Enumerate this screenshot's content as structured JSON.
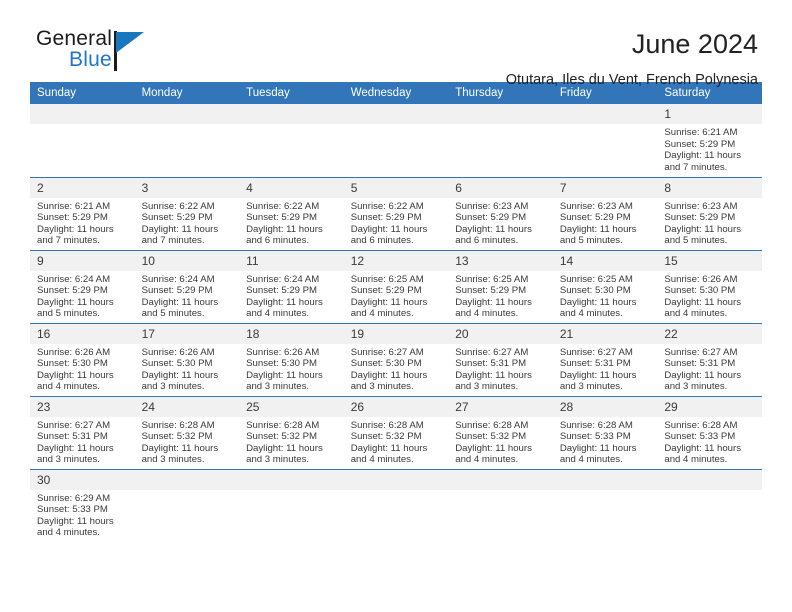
{
  "logo": {
    "general": "General",
    "blue": "Blue",
    "triangle_color": "#1878bd",
    "text_color": "#1b1b1b",
    "blue_color": "#2176c7"
  },
  "header": {
    "title": "June 2024",
    "subtitle": "Otutara, Iles du Vent, French Polynesia"
  },
  "theme": {
    "header_row_bg": "#3275b8",
    "header_row_text": "#ffffff",
    "day_number_bg": "#f1f1f1",
    "row_separator": "#3275b8",
    "body_text": "#3a3a3a"
  },
  "weekday_headers": [
    "Sunday",
    "Monday",
    "Tuesday",
    "Wednesday",
    "Thursday",
    "Friday",
    "Saturday"
  ],
  "weeks": [
    [
      {
        "day": "",
        "empty": true
      },
      {
        "day": "",
        "empty": true
      },
      {
        "day": "",
        "empty": true
      },
      {
        "day": "",
        "empty": true
      },
      {
        "day": "",
        "empty": true
      },
      {
        "day": "",
        "empty": true
      },
      {
        "day": "1",
        "sunrise": "Sunrise: 6:21 AM",
        "sunset": "Sunset: 5:29 PM",
        "daylight_line1": "Daylight: 11 hours",
        "daylight_line2": "and 7 minutes."
      }
    ],
    [
      {
        "day": "2",
        "sunrise": "Sunrise: 6:21 AM",
        "sunset": "Sunset: 5:29 PM",
        "daylight_line1": "Daylight: 11 hours",
        "daylight_line2": "and 7 minutes."
      },
      {
        "day": "3",
        "sunrise": "Sunrise: 6:22 AM",
        "sunset": "Sunset: 5:29 PM",
        "daylight_line1": "Daylight: 11 hours",
        "daylight_line2": "and 7 minutes."
      },
      {
        "day": "4",
        "sunrise": "Sunrise: 6:22 AM",
        "sunset": "Sunset: 5:29 PM",
        "daylight_line1": "Daylight: 11 hours",
        "daylight_line2": "and 6 minutes."
      },
      {
        "day": "5",
        "sunrise": "Sunrise: 6:22 AM",
        "sunset": "Sunset: 5:29 PM",
        "daylight_line1": "Daylight: 11 hours",
        "daylight_line2": "and 6 minutes."
      },
      {
        "day": "6",
        "sunrise": "Sunrise: 6:23 AM",
        "sunset": "Sunset: 5:29 PM",
        "daylight_line1": "Daylight: 11 hours",
        "daylight_line2": "and 6 minutes."
      },
      {
        "day": "7",
        "sunrise": "Sunrise: 6:23 AM",
        "sunset": "Sunset: 5:29 PM",
        "daylight_line1": "Daylight: 11 hours",
        "daylight_line2": "and 5 minutes."
      },
      {
        "day": "8",
        "sunrise": "Sunrise: 6:23 AM",
        "sunset": "Sunset: 5:29 PM",
        "daylight_line1": "Daylight: 11 hours",
        "daylight_line2": "and 5 minutes."
      }
    ],
    [
      {
        "day": "9",
        "sunrise": "Sunrise: 6:24 AM",
        "sunset": "Sunset: 5:29 PM",
        "daylight_line1": "Daylight: 11 hours",
        "daylight_line2": "and 5 minutes."
      },
      {
        "day": "10",
        "sunrise": "Sunrise: 6:24 AM",
        "sunset": "Sunset: 5:29 PM",
        "daylight_line1": "Daylight: 11 hours",
        "daylight_line2": "and 5 minutes."
      },
      {
        "day": "11",
        "sunrise": "Sunrise: 6:24 AM",
        "sunset": "Sunset: 5:29 PM",
        "daylight_line1": "Daylight: 11 hours",
        "daylight_line2": "and 4 minutes."
      },
      {
        "day": "12",
        "sunrise": "Sunrise: 6:25 AM",
        "sunset": "Sunset: 5:29 PM",
        "daylight_line1": "Daylight: 11 hours",
        "daylight_line2": "and 4 minutes."
      },
      {
        "day": "13",
        "sunrise": "Sunrise: 6:25 AM",
        "sunset": "Sunset: 5:29 PM",
        "daylight_line1": "Daylight: 11 hours",
        "daylight_line2": "and 4 minutes."
      },
      {
        "day": "14",
        "sunrise": "Sunrise: 6:25 AM",
        "sunset": "Sunset: 5:30 PM",
        "daylight_line1": "Daylight: 11 hours",
        "daylight_line2": "and 4 minutes."
      },
      {
        "day": "15",
        "sunrise": "Sunrise: 6:26 AM",
        "sunset": "Sunset: 5:30 PM",
        "daylight_line1": "Daylight: 11 hours",
        "daylight_line2": "and 4 minutes."
      }
    ],
    [
      {
        "day": "16",
        "sunrise": "Sunrise: 6:26 AM",
        "sunset": "Sunset: 5:30 PM",
        "daylight_line1": "Daylight: 11 hours",
        "daylight_line2": "and 4 minutes."
      },
      {
        "day": "17",
        "sunrise": "Sunrise: 6:26 AM",
        "sunset": "Sunset: 5:30 PM",
        "daylight_line1": "Daylight: 11 hours",
        "daylight_line2": "and 3 minutes."
      },
      {
        "day": "18",
        "sunrise": "Sunrise: 6:26 AM",
        "sunset": "Sunset: 5:30 PM",
        "daylight_line1": "Daylight: 11 hours",
        "daylight_line2": "and 3 minutes."
      },
      {
        "day": "19",
        "sunrise": "Sunrise: 6:27 AM",
        "sunset": "Sunset: 5:30 PM",
        "daylight_line1": "Daylight: 11 hours",
        "daylight_line2": "and 3 minutes."
      },
      {
        "day": "20",
        "sunrise": "Sunrise: 6:27 AM",
        "sunset": "Sunset: 5:31 PM",
        "daylight_line1": "Daylight: 11 hours",
        "daylight_line2": "and 3 minutes."
      },
      {
        "day": "21",
        "sunrise": "Sunrise: 6:27 AM",
        "sunset": "Sunset: 5:31 PM",
        "daylight_line1": "Daylight: 11 hours",
        "daylight_line2": "and 3 minutes."
      },
      {
        "day": "22",
        "sunrise": "Sunrise: 6:27 AM",
        "sunset": "Sunset: 5:31 PM",
        "daylight_line1": "Daylight: 11 hours",
        "daylight_line2": "and 3 minutes."
      }
    ],
    [
      {
        "day": "23",
        "sunrise": "Sunrise: 6:27 AM",
        "sunset": "Sunset: 5:31 PM",
        "daylight_line1": "Daylight: 11 hours",
        "daylight_line2": "and 3 minutes."
      },
      {
        "day": "24",
        "sunrise": "Sunrise: 6:28 AM",
        "sunset": "Sunset: 5:32 PM",
        "daylight_line1": "Daylight: 11 hours",
        "daylight_line2": "and 3 minutes."
      },
      {
        "day": "25",
        "sunrise": "Sunrise: 6:28 AM",
        "sunset": "Sunset: 5:32 PM",
        "daylight_line1": "Daylight: 11 hours",
        "daylight_line2": "and 3 minutes."
      },
      {
        "day": "26",
        "sunrise": "Sunrise: 6:28 AM",
        "sunset": "Sunset: 5:32 PM",
        "daylight_line1": "Daylight: 11 hours",
        "daylight_line2": "and 4 minutes."
      },
      {
        "day": "27",
        "sunrise": "Sunrise: 6:28 AM",
        "sunset": "Sunset: 5:32 PM",
        "daylight_line1": "Daylight: 11 hours",
        "daylight_line2": "and 4 minutes."
      },
      {
        "day": "28",
        "sunrise": "Sunrise: 6:28 AM",
        "sunset": "Sunset: 5:33 PM",
        "daylight_line1": "Daylight: 11 hours",
        "daylight_line2": "and 4 minutes."
      },
      {
        "day": "29",
        "sunrise": "Sunrise: 6:28 AM",
        "sunset": "Sunset: 5:33 PM",
        "daylight_line1": "Daylight: 11 hours",
        "daylight_line2": "and 4 minutes."
      }
    ],
    [
      {
        "day": "30",
        "sunrise": "Sunrise: 6:29 AM",
        "sunset": "Sunset: 5:33 PM",
        "daylight_line1": "Daylight: 11 hours",
        "daylight_line2": "and 4 minutes."
      },
      {
        "day": "",
        "empty": true
      },
      {
        "day": "",
        "empty": true
      },
      {
        "day": "",
        "empty": true
      },
      {
        "day": "",
        "empty": true
      },
      {
        "day": "",
        "empty": true
      },
      {
        "day": "",
        "empty": true
      }
    ]
  ]
}
